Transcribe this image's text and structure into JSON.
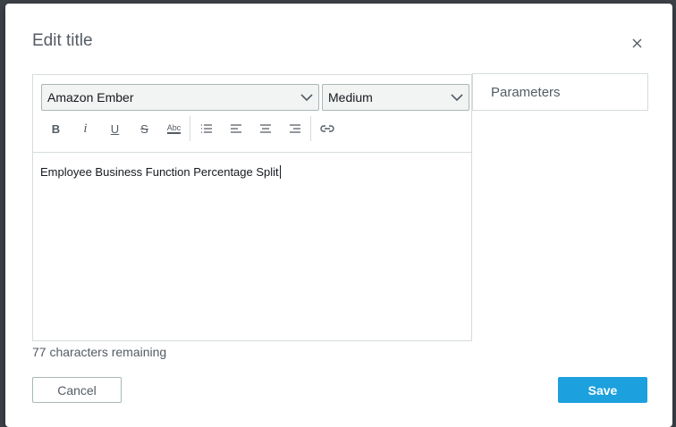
{
  "dialog": {
    "title": "Edit title",
    "close_icon": "close-icon"
  },
  "editor": {
    "font_family": "Amazon Ember",
    "font_size": "Medium",
    "toolbar": [
      {
        "name": "bold",
        "glyph": "B"
      },
      {
        "name": "italic",
        "glyph": "i"
      },
      {
        "name": "underline",
        "glyph": "U"
      },
      {
        "name": "strikethrough",
        "glyph": "S"
      },
      {
        "name": "spellcheck",
        "glyph": "Abc"
      },
      {
        "name": "list",
        "glyph": "list-icon"
      },
      {
        "name": "align-left",
        "glyph": "align-left-icon"
      },
      {
        "name": "align-center",
        "glyph": "align-center-icon"
      },
      {
        "name": "align-right",
        "glyph": "align-right-icon"
      },
      {
        "name": "link",
        "glyph": "link-icon"
      }
    ],
    "content": "Employee Business Function Percentage Split"
  },
  "parameters": {
    "label": "Parameters"
  },
  "status": {
    "chars_remaining": "77 characters remaining"
  },
  "buttons": {
    "cancel": "Cancel",
    "save": "Save"
  },
  "colors": {
    "primary": "#1ca0de",
    "text": "#545b64",
    "border": "#d5dbdb"
  }
}
